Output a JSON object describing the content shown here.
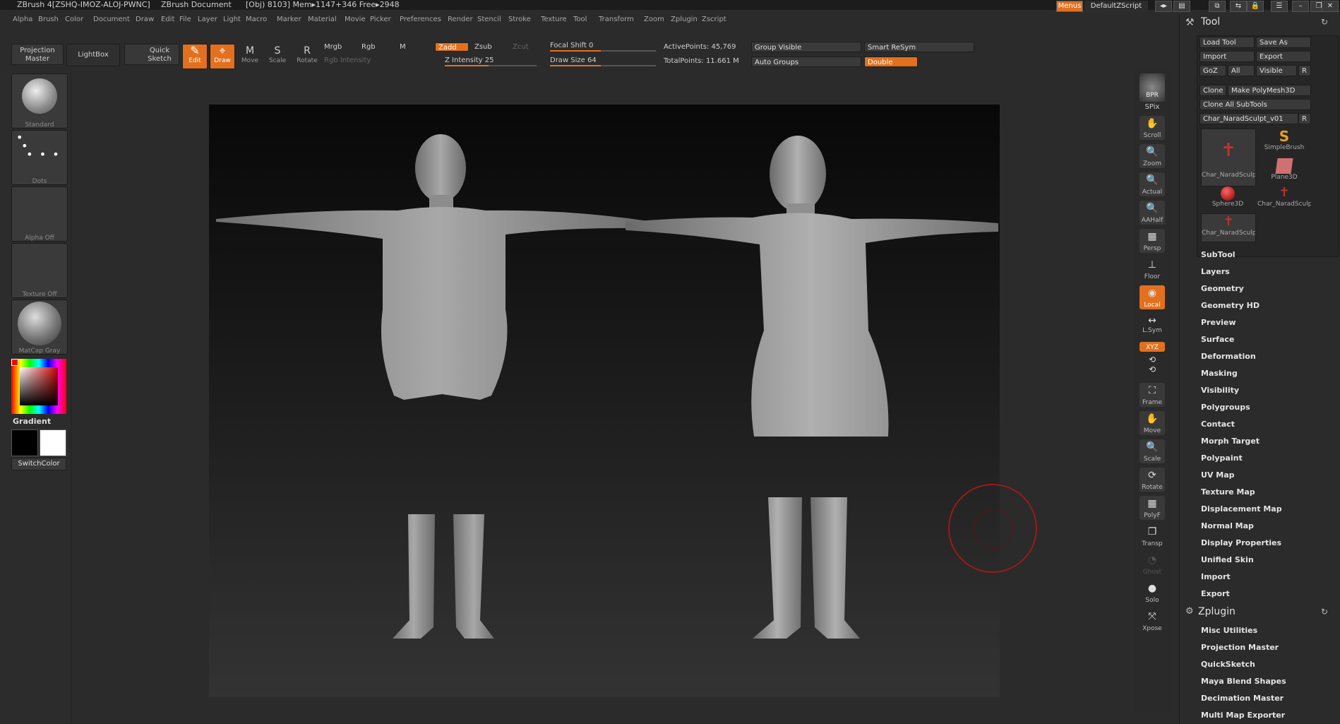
{
  "titlebar": {
    "app": "ZBrush 4[ZSHQ-IMOZ-ALOJ-PWNC]",
    "document": "ZBrush Document",
    "stats": "[Obj) 8103] Mem▸1147+346 Free▸2948",
    "menus_button": "Menus",
    "zscript_name": "DefaultZScript"
  },
  "menubar": [
    "Alpha",
    "Brush",
    "Color",
    "Document",
    "Draw",
    "Edit",
    "File",
    "Layer",
    "Light",
    "Macro",
    "Marker",
    "Material",
    "Movie",
    "Picker",
    "Preferences",
    "Render",
    "Stencil",
    "Stroke",
    "Texture",
    "Tool",
    "Transform",
    "Zoom",
    "Zplugin",
    "Zscript"
  ],
  "shelf": {
    "projection_master": "Projection Master",
    "lightbox": "LightBox",
    "quick_sketch": "Quick Sketch",
    "edit": "Edit",
    "draw": "Draw",
    "move": "Move",
    "scale": "Scale",
    "rotate": "Rotate",
    "mrgb": "Mrgb",
    "rgb": "Rgb",
    "m": "M",
    "rgb_intensity": "Rgb Intensity",
    "zadd": "Zadd",
    "zsub": "Zsub",
    "zcut": "Zcut",
    "z_intensity": "Z Intensity 25",
    "focal_shift": "Focal Shift 0",
    "draw_size": "Draw Size 64",
    "active_points": "ActivePoints: 45,769",
    "total_points": "TotalPoints: 11.661 M",
    "group_visible": "Group Visible",
    "auto_groups": "Auto Groups",
    "smart_resym": "Smart ReSym",
    "double": "Double"
  },
  "left_tray": {
    "brush": "Standard",
    "stroke": "Dots",
    "alpha": "Alpha Off",
    "texture": "Texture Off",
    "material": "MatCap Gray",
    "gradient": "Gradient",
    "switch_color": "SwitchColor"
  },
  "right_bar": [
    "BPR",
    "SPix",
    "Scroll",
    "Zoom",
    "Actual",
    "AAHalf",
    "Persp",
    "Floor",
    "Local",
    "L.Sym",
    "XYZ",
    "Frame",
    "Move",
    "Scale",
    "Rotate",
    "PolyF",
    "Transp",
    "Ghost",
    "Solo",
    "Xpose"
  ],
  "tool_palette": {
    "title": "Tool",
    "load_tool": "Load Tool",
    "save_as": "Save As",
    "import": "Import",
    "export": "Export",
    "goz": "GoZ",
    "all": "All",
    "visible": "Visible",
    "r": "R",
    "clone": "Clone",
    "make_polymesh": "Make PolyMesh3D",
    "clone_all": "Clone All SubTools",
    "current_tool": "Char_NaradSculpt_v01",
    "subtools": [
      "Char_NaradSculp",
      "SimpleBrush",
      "Plane3D",
      "Sphere3D",
      "Char_NaradSculp",
      "Char_NaradSculp"
    ],
    "sections": [
      "SubTool",
      "Layers",
      "Geometry",
      "Geometry HD",
      "Preview",
      "Surface",
      "Deformation",
      "Masking",
      "Visibility",
      "Polygroups",
      "Contact",
      "Morph Target",
      "Polypaint",
      "UV Map",
      "Texture Map",
      "Displacement Map",
      "Normal Map",
      "Display Properties",
      "Unified Skin",
      "Import",
      "Export"
    ],
    "zplugin_title": "Zplugin",
    "zplugin_items": [
      "Misc Utilities",
      "Projection Master",
      "QuickSketch",
      "Maya Blend Shapes",
      "Decimation Master",
      "Multi Map Exporter"
    ]
  },
  "colors": {
    "accent": "#e2701e",
    "panel": "#2b2b2b",
    "button": "#3a3a3a"
  }
}
